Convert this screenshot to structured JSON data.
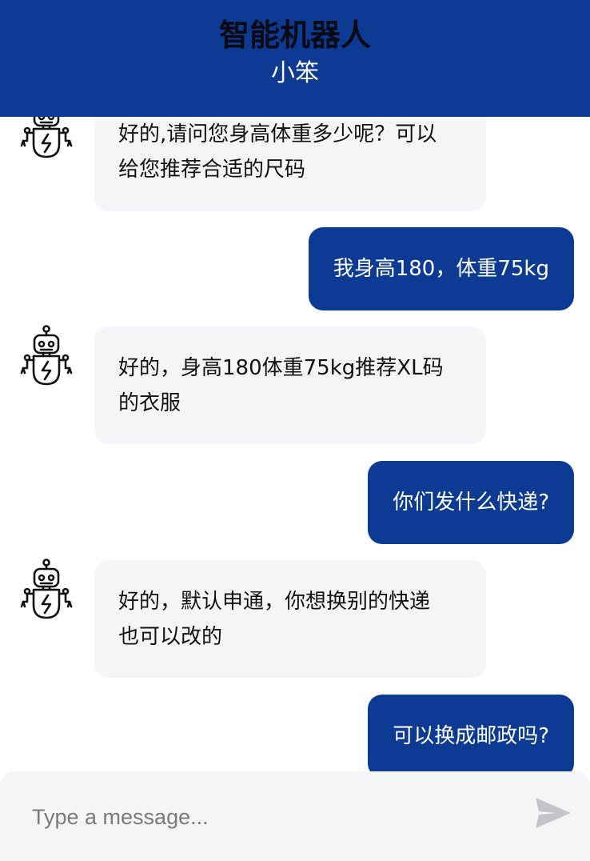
{
  "header": {
    "title": "智能机器人",
    "subtitle": "小笨"
  },
  "messages": [
    {
      "sender": "bot",
      "lines": [
        "好的,请问您身高体重多少呢？可以",
        "给您推荐合适的尺码"
      ]
    },
    {
      "sender": "user",
      "text": "我身高180，体重75kg"
    },
    {
      "sender": "bot",
      "lines": [
        "好的，身高180体重75kg推荐XL码",
        "的衣服"
      ]
    },
    {
      "sender": "user",
      "text": "你们发什么快递?"
    },
    {
      "sender": "bot",
      "lines": [
        "好的，默认申通，你想换别的快递",
        "也可以改的"
      ]
    },
    {
      "sender": "user",
      "text": "可以换成邮政吗?"
    }
  ],
  "composer": {
    "placeholder": "Type a message..."
  },
  "icons": {
    "avatar": "robot-icon",
    "send": "send-icon"
  },
  "colors": {
    "header_bg": "#0d3b94",
    "user_bubble": "#0d3b94",
    "bot_bubble": "#f4f5f7",
    "composer_bg": "#f4f5f7"
  }
}
